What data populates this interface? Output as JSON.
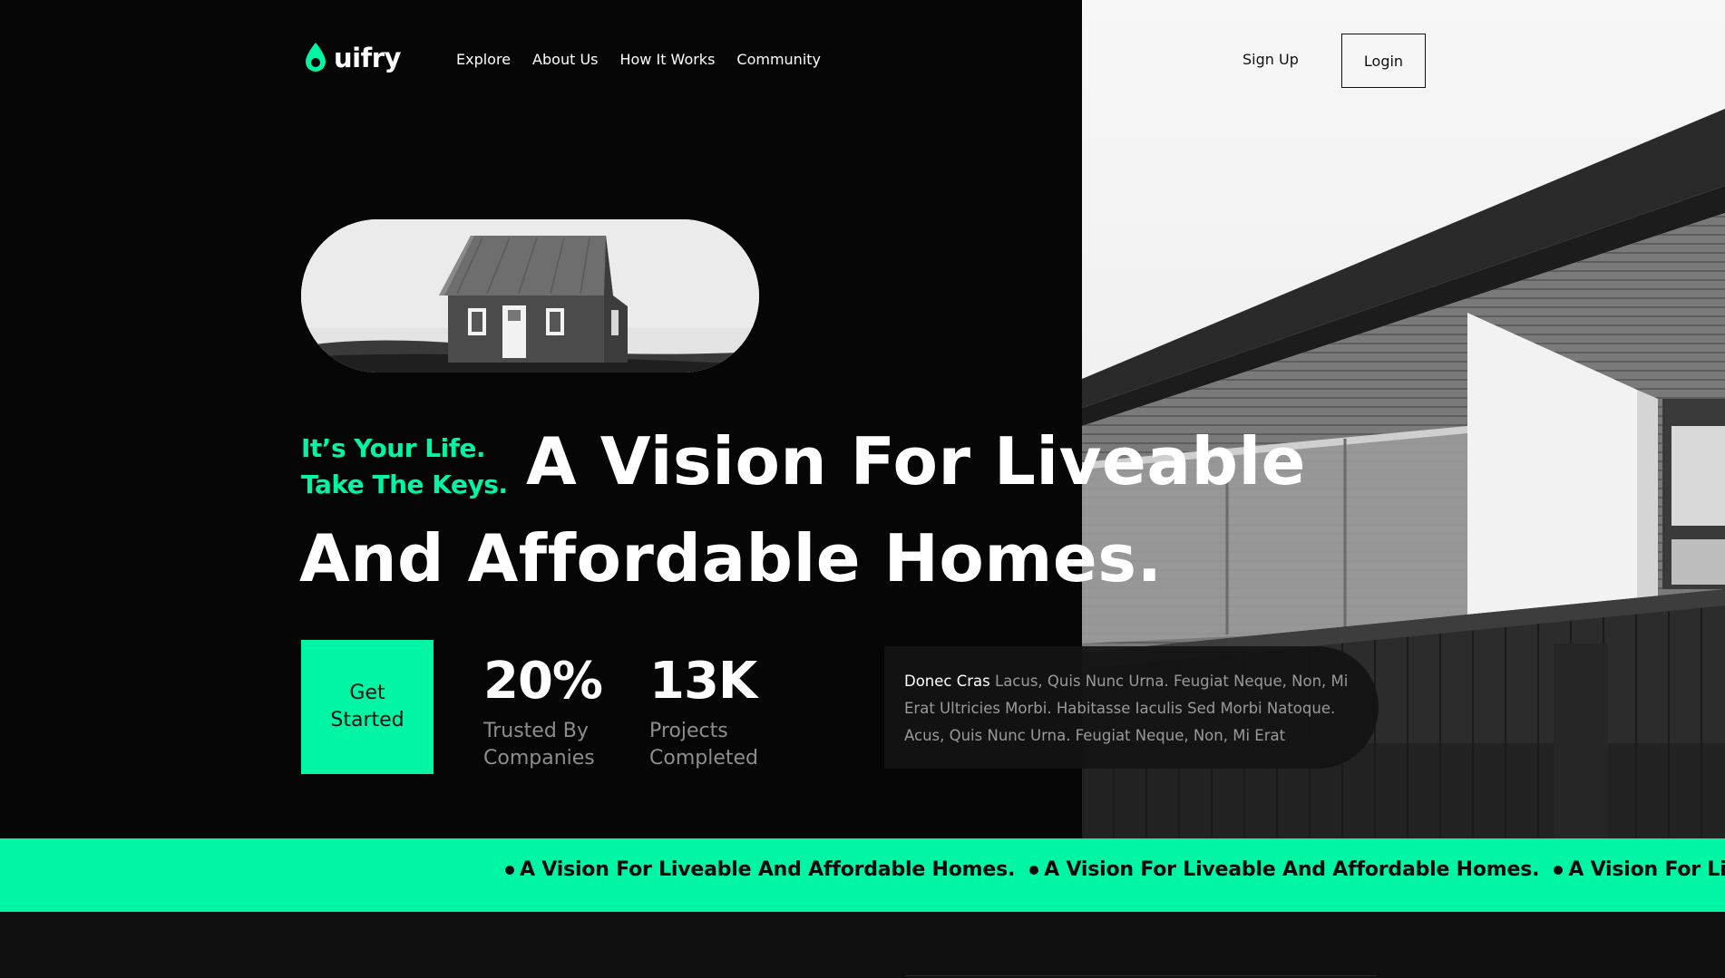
{
  "brand": {
    "name": "uifry",
    "accent": "#00f5a4"
  },
  "nav": {
    "items": [
      {
        "label": "Explore"
      },
      {
        "label": "About Us"
      },
      {
        "label": "How It Works"
      },
      {
        "label": "Community"
      }
    ],
    "signup_label": "Sign Up",
    "login_label": "Login"
  },
  "hero": {
    "tagline_line1": "It’s Your Life.",
    "tagline_line2": "Take The Keys.",
    "headline_line1": "A Vision For Liveable",
    "headline_line2": "And Affordable Homes.",
    "cta_label": "Get Started",
    "stats": [
      {
        "value": "20%",
        "label": "Trusted By Companies"
      },
      {
        "value": "13K",
        "label": "Projects Completed"
      }
    ],
    "card": {
      "lead": "Donec Cras",
      "body": " Lacus, Quis Nunc Urna. Feugiat Neque, Non, Mi Erat Ultricies Morbi. Habitasse Iaculis Sed Morbi Natoque. Acus, Quis Nunc Urna. Feugiat Neque, Non, Mi Erat"
    }
  },
  "marquee": {
    "items": [
      {
        "text": "A Vision For Liveable And Affordable Homes."
      },
      {
        "text": "A Vision For Liveable And Affordable Homes."
      },
      {
        "text": "A Vision For Liveable And Affordable Homes."
      }
    ]
  }
}
